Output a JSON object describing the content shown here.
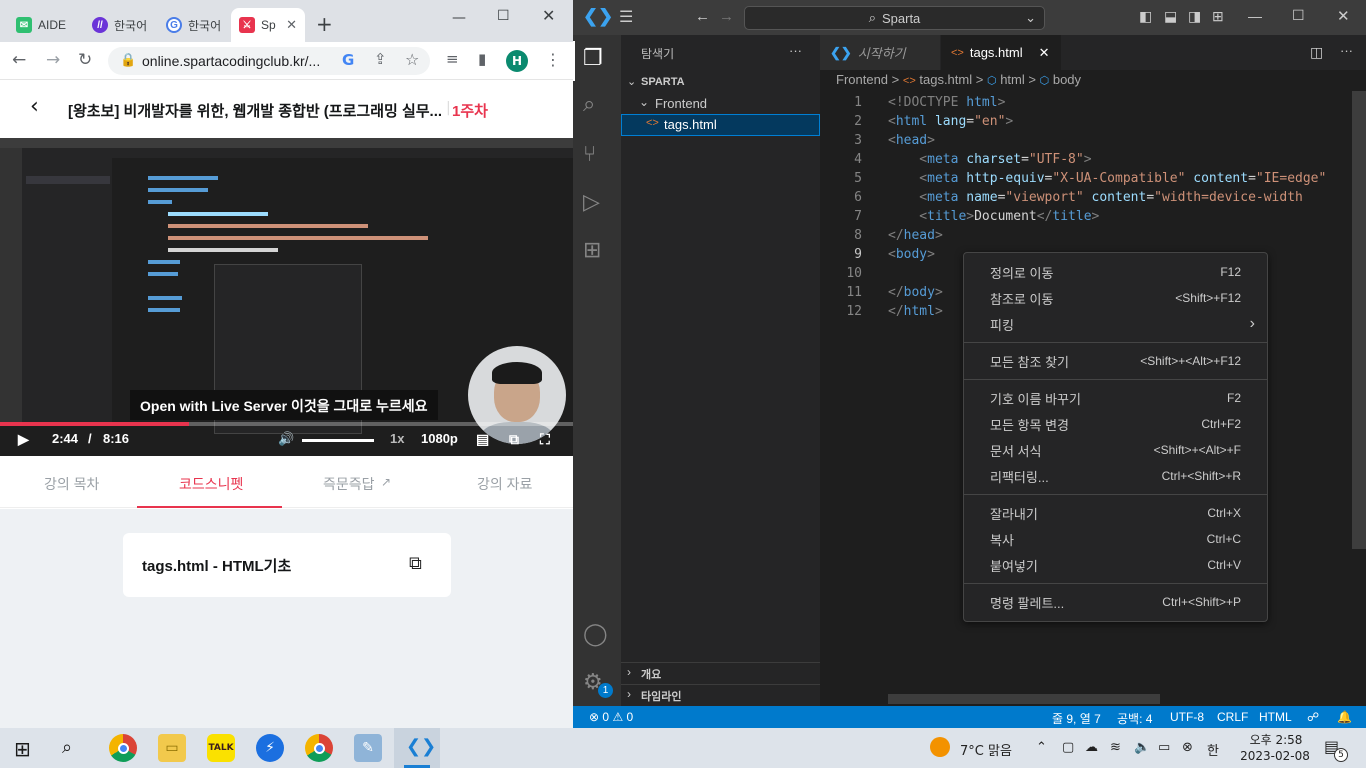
{
  "chrome": {
    "tabs": [
      {
        "label": "AIDE"
      },
      {
        "label": "한국어"
      },
      {
        "label": "한국어"
      },
      {
        "label": "Sp"
      }
    ],
    "new_tab_label": "+",
    "url": "online.spartacodingclub.kr/...",
    "profile_initial": "H"
  },
  "course": {
    "title": "[왕초보] 비개발자를 위한, 웹개발 종합반 (프로그래밍 실무...",
    "week": "1주차"
  },
  "video": {
    "subtitle": "Open with Live Server 이것을 그대로 누르세요",
    "current_time": "2:44",
    "separator": "/",
    "duration": "8:16",
    "speed": "1x",
    "quality": "1080p",
    "progress_fraction": 0.33
  },
  "lecture_tabs": {
    "items": [
      {
        "label": "강의 목차"
      },
      {
        "label": "코드스니펫"
      },
      {
        "label": "즉문즉답"
      },
      {
        "label": "강의 자료"
      }
    ]
  },
  "snippet": {
    "title": "tags.html - HTML기초"
  },
  "vscode": {
    "command_center": "Sparta",
    "sidebar": {
      "title": "탐색기",
      "more": "···",
      "root": "SPARTA",
      "folder": "Frontend",
      "file": "tags.html",
      "outline": "개요",
      "timeline": "타임라인"
    },
    "tabs": [
      {
        "label": "시작하기"
      },
      {
        "label": "tags.html"
      }
    ],
    "breadcrumb": {
      "folder": "Frontend",
      "file": "tags.html",
      "el1": "html",
      "el2": "body",
      "sep": ">"
    },
    "line_numbers": [
      "1",
      "2",
      "3",
      "4",
      "5",
      "6",
      "7",
      "8",
      "9",
      "10",
      "11",
      "12"
    ],
    "code": {
      "l1a": "<!DOCTYPE ",
      "l1b": "html",
      "l1c": ">",
      "l2a": "<",
      "l2b": "html",
      "l2c": " lang",
      "l2d": "=",
      "l2e": "\"en\"",
      "l2f": ">",
      "l3a": "<",
      "l3b": "head",
      "l3c": ">",
      "l4a": "    <",
      "l4b": "meta",
      "l4c": " charset",
      "l4d": "=",
      "l4e": "\"UTF-8\"",
      "l4f": ">",
      "l5a": "    <",
      "l5b": "meta",
      "l5c": " http-equiv",
      "l5d": "=",
      "l5e": "\"X-UA-Compatible\"",
      "l5f": " content",
      "l5g": "=",
      "l5h": "\"IE=edge\"",
      "l6a": "    <",
      "l6b": "meta",
      "l6c": " name",
      "l6d": "=",
      "l6e": "\"viewport\"",
      "l6f": " content",
      "l6g": "=",
      "l6h": "\"width=device-width",
      "l7a": "    <",
      "l7b": "title",
      "l7c": ">",
      "l7d": "Document",
      "l7e": "</",
      "l7f": "title",
      "l7g": ">",
      "l8a": "</",
      "l8b": "head",
      "l8c": ">",
      "l9a": "<",
      "l9b": "body",
      "l9c": ">",
      "l11a": "</",
      "l11b": "body",
      "l11c": ">",
      "l12a": "</",
      "l12b": "html",
      "l12c": ">"
    },
    "context_menu": {
      "items": [
        {
          "label": "정의로 이동",
          "key": "F12"
        },
        {
          "label": "참조로 이동",
          "key": "<Shift>+F12"
        },
        {
          "label": "피킹",
          "key": "›"
        },
        {
          "label": "모든 참조 찾기",
          "key": "<Shift>+<Alt>+F12"
        },
        {
          "label": "기호 이름 바꾸기",
          "key": "F2"
        },
        {
          "label": "모든 항목 변경",
          "key": "Ctrl+F2"
        },
        {
          "label": "문서 서식",
          "key": "<Shift>+<Alt>+F"
        },
        {
          "label": "리팩터링...",
          "key": "Ctrl+<Shift>+R"
        },
        {
          "label": "잘라내기",
          "key": "Ctrl+X"
        },
        {
          "label": "복사",
          "key": "Ctrl+C"
        },
        {
          "label": "붙여넣기",
          "key": "Ctrl+V"
        },
        {
          "label": "명령 팔레트...",
          "key": "Ctrl+<Shift>+P"
        }
      ]
    },
    "status": {
      "errors": "0",
      "warnings": "0",
      "position": "줄 9, 열 7",
      "spaces": "공백: 4",
      "encoding": "UTF-8",
      "eol": "CRLF",
      "language": "HTML"
    },
    "settings_badge": "1"
  },
  "taskbar": {
    "weather": "7°C  맑음",
    "ime": "한",
    "time": "오후 2:58",
    "date": "2023-02-08",
    "notifications": "5",
    "kakao_label": "TALK"
  },
  "colors": {
    "accent": "#e8344e",
    "vscode_blue": "#007acc"
  }
}
